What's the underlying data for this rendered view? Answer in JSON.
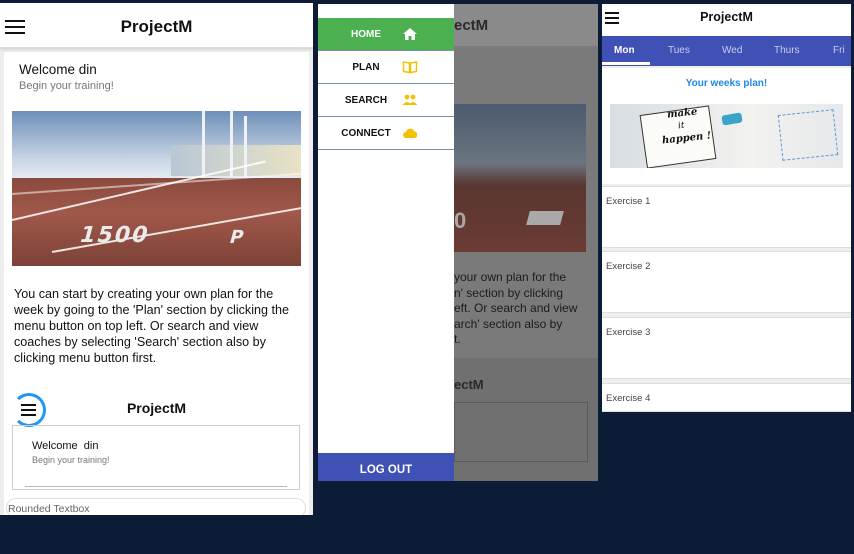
{
  "app": {
    "title": "ProjectM"
  },
  "home": {
    "welcome": "Welcome din",
    "subtitle": "Begin your training!",
    "hero_number": "1500",
    "hero_letter": "P",
    "intro": "You can start by creating your own plan for the week by going to the 'Plan' section by clicking the menu button on top left. Or search and view coaches by selecting 'Search' section also by clicking menu button first.",
    "nested": {
      "title": "ProjectM",
      "welcome": "Welcome  din",
      "subtitle": "Begin your training!",
      "bottom_label": "Rounded Textbox"
    }
  },
  "drawer": {
    "items": [
      {
        "label": "HOME",
        "icon": "home-icon",
        "color": "#ffffff"
      },
      {
        "label": "PLAN",
        "icon": "book-icon",
        "color": "#f2c200"
      },
      {
        "label": "SEARCH",
        "icon": "people-icon",
        "color": "#f2c200"
      },
      {
        "label": "CONNECT",
        "icon": "cloud-icon",
        "color": "#f2c200"
      }
    ],
    "logout": "LOG OUT",
    "background_fragments": {
      "title": "ectM",
      "lines": [
        "your own plan for the",
        "n' section by clicking",
        "eft. Or search and view",
        "arch' section also by",
        "t."
      ],
      "title2": "ectM",
      "hero_frag": "0"
    }
  },
  "plan": {
    "tabs": [
      "Mon",
      "Tues",
      "Wed",
      "Thurs",
      "Fri"
    ],
    "active_tab": "Mon",
    "heading": "Your weeks plan!",
    "banner_text": [
      "make",
      "it",
      "happen !"
    ],
    "exercises": [
      "Exercise 1",
      "Exercise 2",
      "Exercise 3",
      "Exercise 4"
    ]
  },
  "colors": {
    "primary": "#3f51b5",
    "accent": "#4caf50",
    "background": "#0c1b36",
    "link": "#2196f3"
  }
}
